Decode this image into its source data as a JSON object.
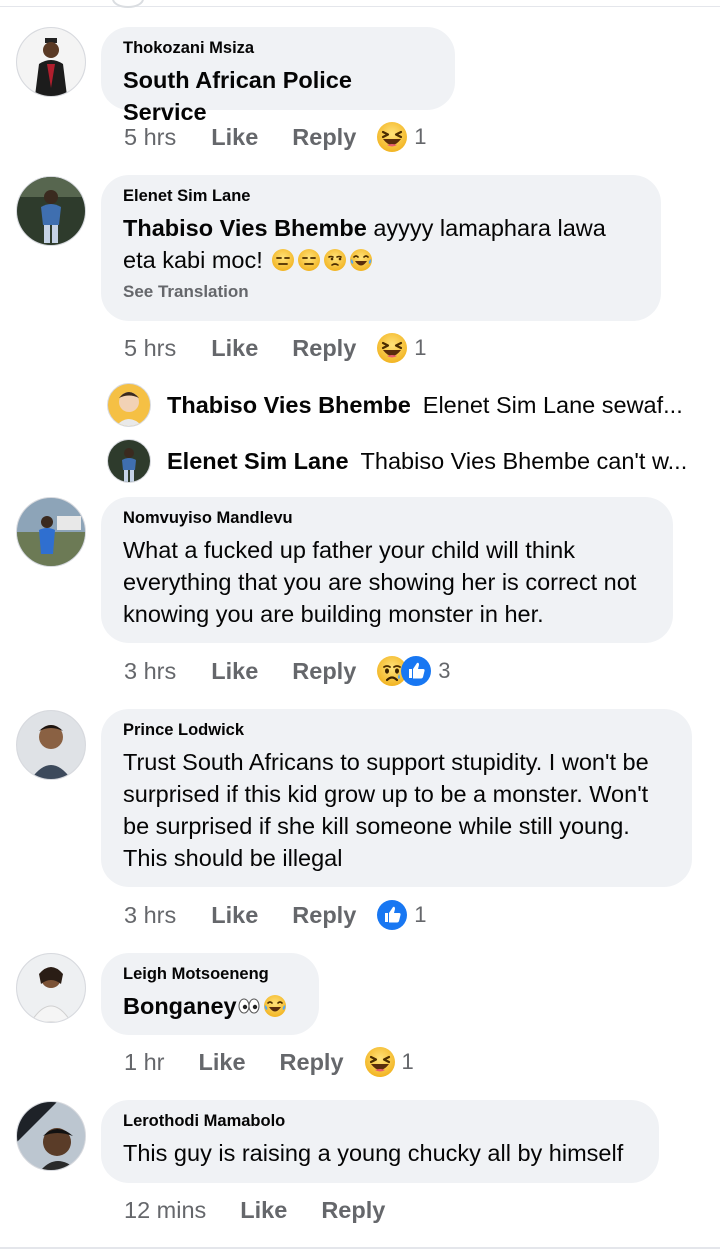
{
  "comments": [
    {
      "author": "Thokozani Msiza",
      "text": "South African Police Service",
      "time": "5 hrs",
      "like_label": "Like",
      "reply_label": "Reply",
      "reactions": [
        "laugh"
      ],
      "reaction_count": "1",
      "avatar_icon": "graduate-avatar"
    },
    {
      "author": "Elenet Sim Lane",
      "mention": "Thabiso Vies Bhembe",
      "text": "ayyyy lamaphara lawa eta kabi moc!",
      "text_emojis": [
        "expressionless",
        "expressionless",
        "unamused",
        "tears-of-joy"
      ],
      "see_translation": "See Translation",
      "time": "5 hrs",
      "like_label": "Like",
      "reply_label": "Reply",
      "reactions": [
        "laugh"
      ],
      "reaction_count": "1",
      "avatar_icon": "person-avatar",
      "replies": [
        {
          "name": "Thabiso Vies Bhembe",
          "text": "Elenet Sim Lane sewaf...",
          "avatar_icon": "cartoon-avatar"
        },
        {
          "name": "Elenet Sim Lane",
          "text": "Thabiso Vies Bhembe can't w...",
          "avatar_icon": "person-avatar"
        }
      ]
    },
    {
      "author": "Nomvuyiso Mandlevu",
      "text": "What a fucked up father your child will think everything that you are showing her is correct not knowing you are building monster in her.",
      "time": "3 hrs",
      "like_label": "Like",
      "reply_label": "Reply",
      "reactions": [
        "sad",
        "like"
      ],
      "reaction_count": "3",
      "avatar_icon": "outdoor-avatar"
    },
    {
      "author": "Prince Lodwick",
      "text": "Trust South Africans to support stupidity. I won't be surprised if this kid grow up to be a monster. Won't be surprised if she kill someone while still young. This should be illegal",
      "time": "3 hrs",
      "like_label": "Like",
      "reply_label": "Reply",
      "reactions": [
        "like"
      ],
      "reaction_count": "1",
      "avatar_icon": "portrait-avatar"
    },
    {
      "author": "Leigh Motsoeneng",
      "text": "Bonganey",
      "text_emojis": [
        "eyes",
        "tears-of-joy"
      ],
      "time": "1 hr",
      "like_label": "Like",
      "reply_label": "Reply",
      "reactions": [
        "laugh"
      ],
      "reaction_count": "1",
      "avatar_icon": "woman-avatar"
    },
    {
      "author": "Lerothodi Mamabolo",
      "text": "This guy is raising a young chucky all by himself",
      "time": "12 mins",
      "like_label": "Like",
      "reply_label": "Reply",
      "avatar_icon": "car-selfie-avatar"
    }
  ],
  "colors": {
    "bubble": "#f0f2f5",
    "meta": "#65676b",
    "text": "#050505",
    "like_blue": "#1877f2",
    "emoji_yellow": "#f7c33c"
  }
}
